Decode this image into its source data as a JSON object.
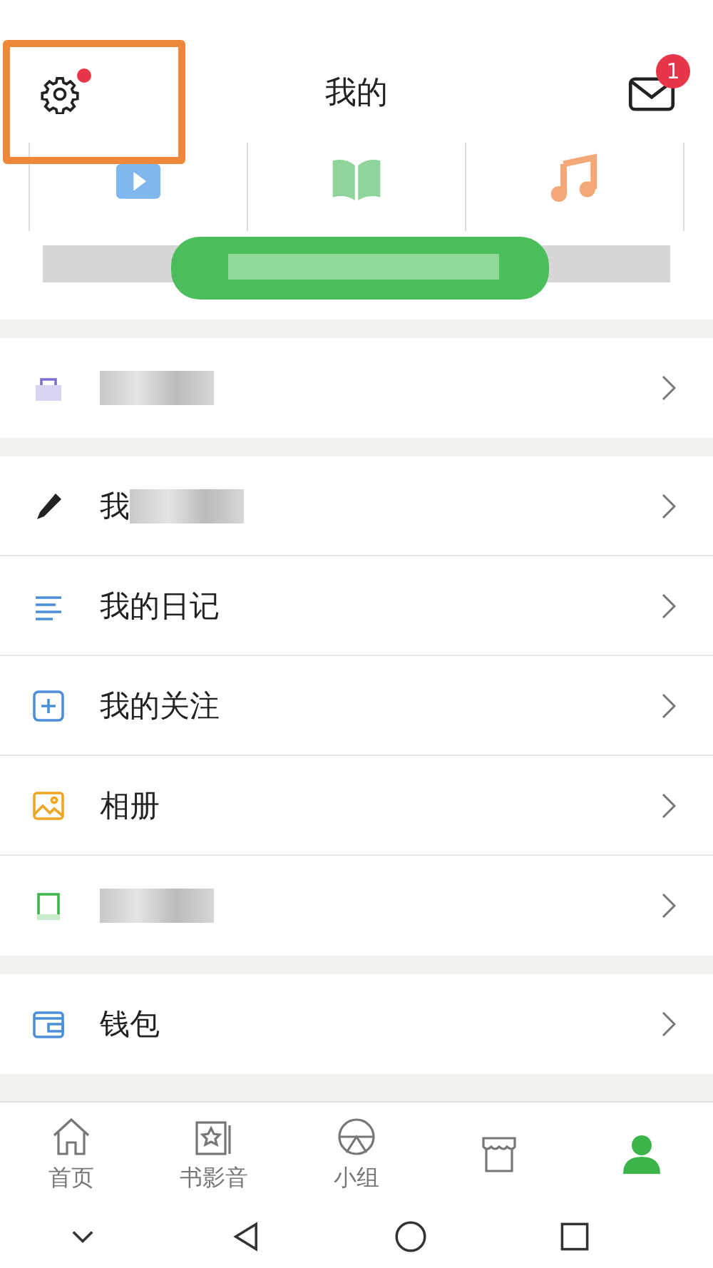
{
  "header": {
    "title": "我的",
    "settings_dot": true,
    "mail_badge": "1",
    "settings_highlighted": true
  },
  "shortcuts": [
    {
      "kind": "video"
    },
    {
      "kind": "book"
    },
    {
      "kind": "music"
    }
  ],
  "groups": [
    [
      {
        "kind": "bag",
        "blurred": true
      }
    ],
    [
      {
        "kind": "pen",
        "label": "我",
        "blurred": true
      },
      {
        "kind": "lines",
        "label": "我的日记",
        "blurred": false
      },
      {
        "kind": "plus",
        "label": "我的关注",
        "blurred": false
      },
      {
        "kind": "image",
        "label": "相册",
        "blurred": false
      },
      {
        "kind": "bookmark",
        "blurred": true
      }
    ],
    [
      {
        "kind": "wallet",
        "label": "钱包",
        "blurred": false
      }
    ]
  ],
  "tabs": [
    {
      "kind": "home",
      "label": "首页",
      "selected": false
    },
    {
      "kind": "cards",
      "label": "书影音",
      "selected": false
    },
    {
      "kind": "ball",
      "label": "小组",
      "selected": false
    },
    {
      "kind": "shop",
      "selected": false
    },
    {
      "kind": "person",
      "selected": true
    }
  ]
}
